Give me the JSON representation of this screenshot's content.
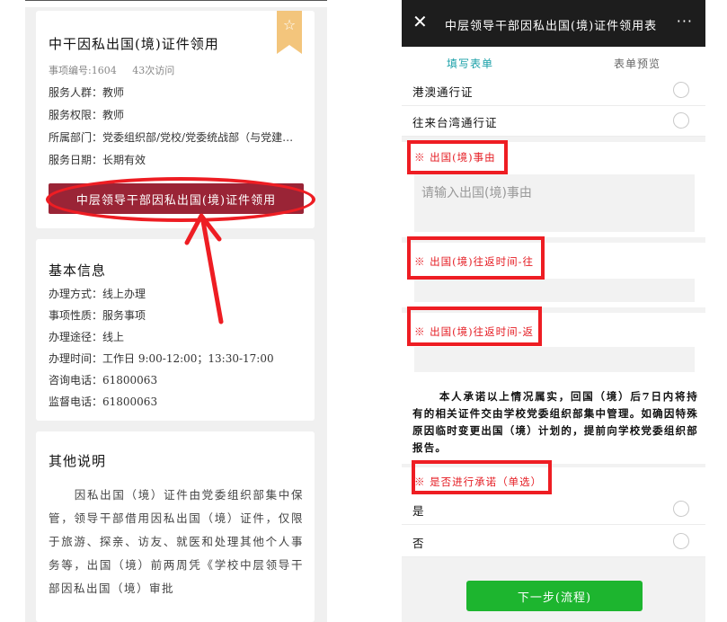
{
  "left": {
    "service": {
      "title": "中干因私出国(境)证件领用",
      "item_no": "事项编号:1604",
      "visits": "43次访问",
      "audience": "服务人群：教师",
      "permission": "服务权限：教师",
      "department": "所属部门：党委组织部/党校/党委统战部（与党建…",
      "date": "服务日期：长期有效",
      "apply_button": "中层领导干部因私出国(境)证件领用"
    },
    "basic_info": {
      "title": "基本信息",
      "rows": [
        "办理方式：线上办理",
        "事项性质：服务事项",
        "办理途径：线上",
        "办理时间：工作日 9:00-12:00；13:30-17:00",
        "咨询电话：61800063",
        "监督电话：61800063"
      ]
    },
    "other": {
      "title": "其他说明",
      "text": "因私出国（境）证件由党委组织部集中保管，领导干部借用因私出国（境）证件，仅限于旅游、探亲、访友、就医和处理其他个人事务等，出国（境）前两周凭《学校中层领导干部因私出国（境）审批"
    },
    "bookmark_icon": "star-outline-icon"
  },
  "right": {
    "header": {
      "close": "✕",
      "title": "中层领导干部因私出国(境)证件领用表",
      "more": "···"
    },
    "tabs": [
      "填写表单",
      "表单预览"
    ],
    "options_top": [
      "港澳通行证",
      "往来台湾通行证"
    ],
    "reason": {
      "label": "※ 出国(境)事由",
      "placeholder": "请输入出国(境)事由"
    },
    "depart_label": "※ 出国(境)往返时间-往",
    "return_label": "※ 出国(境)往返时间-返",
    "statement": "本人承诺以上情况属实，回国（境）后7日内将持有的相关证件交由学校党委组织部集中管理。如确因特殊原因临时变更出国（境）计划的，提前向学校党委组织部报告。",
    "commit": {
      "label": "※ 是否进行承诺（单选）",
      "options": [
        "是",
        "否"
      ]
    },
    "next_button": "下一步(流程)"
  },
  "colors": {
    "primary_red": "#9a2436",
    "annotation_red": "#ee1d23",
    "tab_teal": "#1aa0a8",
    "next_green": "#1db52f",
    "bookmark_gold": "#f3c57c"
  }
}
